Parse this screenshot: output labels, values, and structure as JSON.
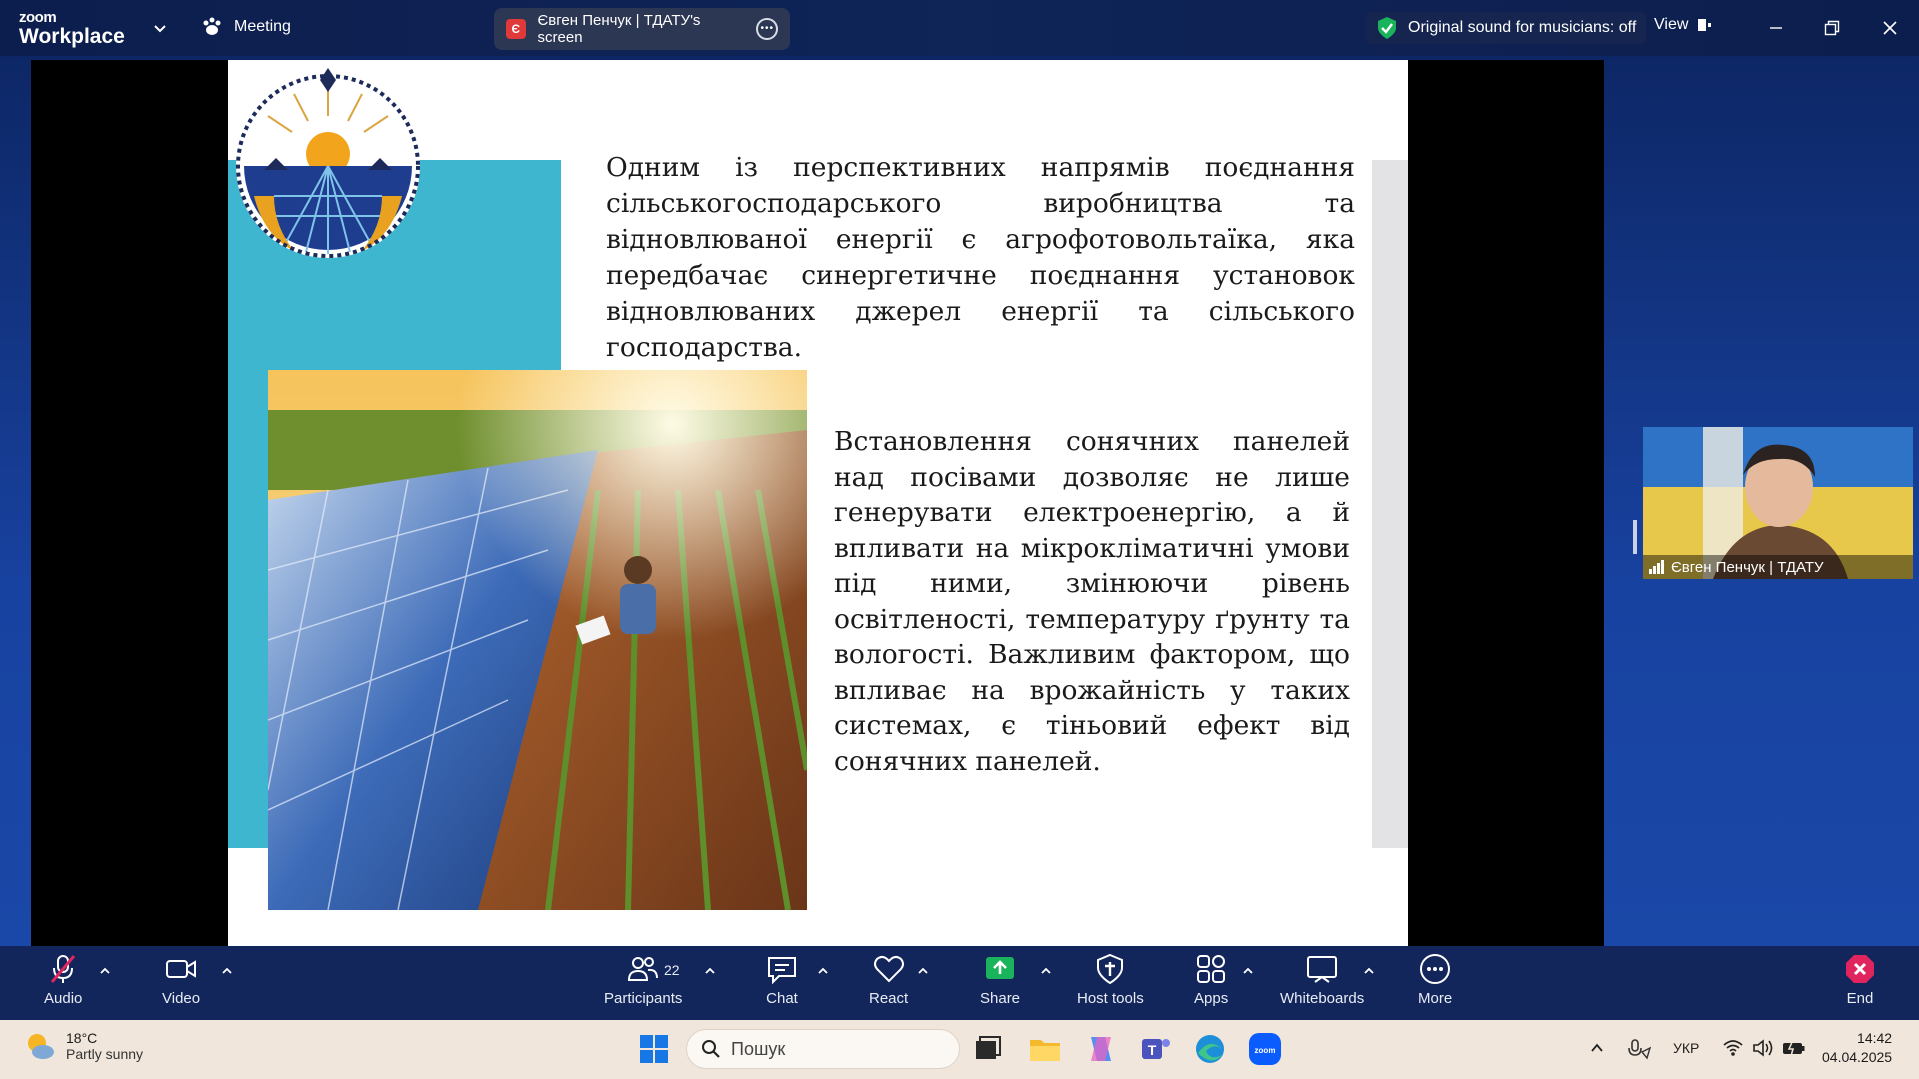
{
  "titlebar": {
    "logo_top": "zoom",
    "logo_bottom": "Workplace",
    "meeting_label": "Meeting",
    "share_badge": "Є",
    "share_label": "Євген Пенчук | ТДАТУ's screen",
    "original_sound": "Original sound for musicians: off",
    "view_label": "View"
  },
  "slide": {
    "paragraph1": "Одним із перспективних напрямів поєднання сільськогосподарського виробництва та відновлюваної енергії є агрофотовольтаїка, яка передбачає синергетичне поєднання установок відновлюваних джерел енергії та сільського господарства.",
    "paragraph2": "Встановлення сонячних панелей над посівами дозволяє не лише генерувати електроенергію, а й впливати на мікрокліматичні умови під ними, змінюючи рівень освітленості, температуру ґрунту та вологості. Важливим фактором, що впливає на врожайність у таких системах, є тіньовий ефект від сонячних панелей."
  },
  "self_video": {
    "name": "Євген Пенчук | ТДАТУ"
  },
  "toolbar": {
    "audio": "Audio",
    "video": "Video",
    "participants": "Participants",
    "participants_count": "22",
    "chat": "Chat",
    "react": "React",
    "share": "Share",
    "host_tools": "Host tools",
    "apps": "Apps",
    "whiteboards": "Whiteboards",
    "more": "More",
    "end": "End"
  },
  "taskbar": {
    "weather_temp": "18°C",
    "weather_desc": "Partly sunny",
    "search_placeholder": "Пошук",
    "language": "УКР",
    "time": "14:42",
    "date": "04.04.2025"
  },
  "colors": {
    "zoom_bg": "#0c1e4d",
    "slide_teal": "#3fb6cf",
    "share_green": "#19b35b",
    "end_red": "#e0245e",
    "taskbar_bg": "#f1e6db"
  }
}
